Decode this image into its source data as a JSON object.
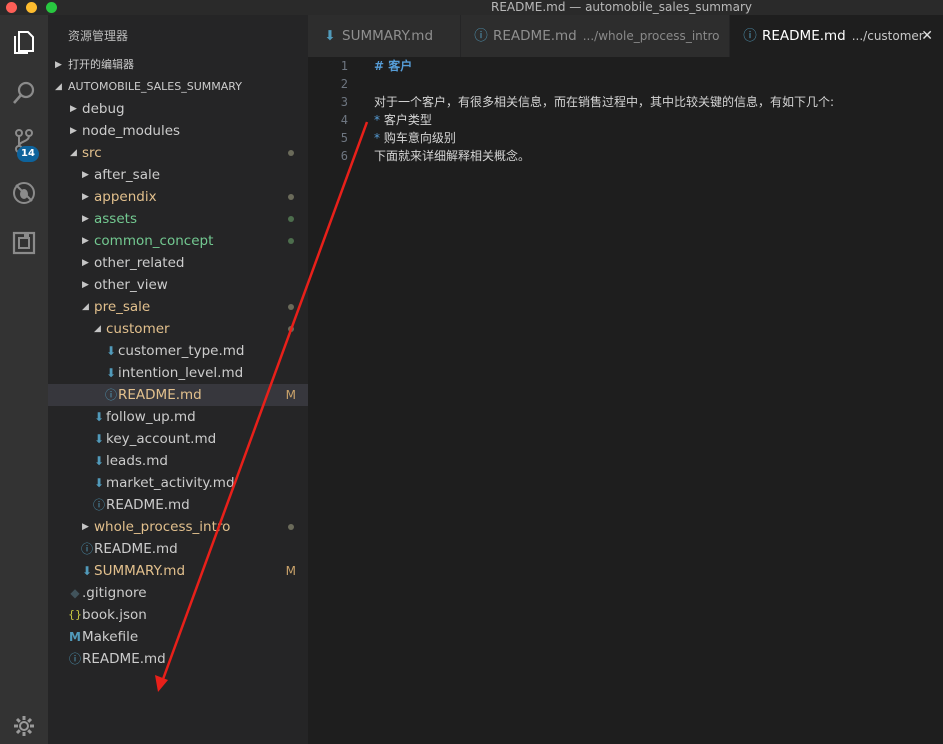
{
  "window": {
    "title": "README.md — automobile_sales_summary"
  },
  "activity_bar": {
    "scm_badge": "14"
  },
  "sidebar": {
    "title": "资源管理器",
    "open_editors_label": "打开的编辑器",
    "project_label": "AUTOMOBILE_SALES_SUMMARY",
    "items": [
      {
        "label": "debug",
        "kind": "folder",
        "depth": 1,
        "expanded": false,
        "color": "folder"
      },
      {
        "label": "node_modules",
        "kind": "folder",
        "depth": 1,
        "expanded": false,
        "color": "folder"
      },
      {
        "label": "src",
        "kind": "folder",
        "depth": 1,
        "expanded": true,
        "color": "mod",
        "dot": "gray"
      },
      {
        "label": "after_sale",
        "kind": "folder",
        "depth": 2,
        "expanded": false,
        "color": "folder"
      },
      {
        "label": "appendix",
        "kind": "folder",
        "depth": 2,
        "expanded": false,
        "color": "mod",
        "dot": "gray"
      },
      {
        "label": "assets",
        "kind": "folder",
        "depth": 2,
        "expanded": false,
        "color": "new",
        "dot": "green"
      },
      {
        "label": "common_concept",
        "kind": "folder",
        "depth": 2,
        "expanded": false,
        "color": "new",
        "dot": "green"
      },
      {
        "label": "other_related",
        "kind": "folder",
        "depth": 2,
        "expanded": false,
        "color": "folder"
      },
      {
        "label": "other_view",
        "kind": "folder",
        "depth": 2,
        "expanded": false,
        "color": "folder"
      },
      {
        "label": "pre_sale",
        "kind": "folder",
        "depth": 2,
        "expanded": true,
        "color": "mod",
        "dot": "gray"
      },
      {
        "label": "customer",
        "kind": "folder",
        "depth": 3,
        "expanded": true,
        "color": "mod",
        "dot": "gray"
      },
      {
        "label": "customer_type.md",
        "kind": "md",
        "depth": 4,
        "color": "folder"
      },
      {
        "label": "intention_level.md",
        "kind": "md",
        "depth": 4,
        "color": "folder"
      },
      {
        "label": "README.md",
        "kind": "info",
        "depth": 4,
        "color": "mod",
        "status": "M",
        "selected": true
      },
      {
        "label": "follow_up.md",
        "kind": "md",
        "depth": 3,
        "color": "folder"
      },
      {
        "label": "key_account.md",
        "kind": "md",
        "depth": 3,
        "color": "folder"
      },
      {
        "label": "leads.md",
        "kind": "md",
        "depth": 3,
        "color": "folder"
      },
      {
        "label": "market_activity.md",
        "kind": "md",
        "depth": 3,
        "color": "folder"
      },
      {
        "label": "README.md",
        "kind": "info",
        "depth": 3,
        "color": "folder"
      },
      {
        "label": "whole_process_intro",
        "kind": "folder",
        "depth": 2,
        "expanded": false,
        "color": "mod",
        "dot": "gray"
      },
      {
        "label": "README.md",
        "kind": "info",
        "depth": 2,
        "color": "folder"
      },
      {
        "label": "SUMMARY.md",
        "kind": "md",
        "depth": 2,
        "color": "mod",
        "status": "M"
      },
      {
        "label": ".gitignore",
        "kind": "git",
        "depth": 1,
        "color": "folder"
      },
      {
        "label": "book.json",
        "kind": "json",
        "depth": 1,
        "color": "folder"
      },
      {
        "label": "Makefile",
        "kind": "make",
        "depth": 1,
        "color": "folder"
      },
      {
        "label": "README.md",
        "kind": "info",
        "depth": 1,
        "color": "folder"
      }
    ]
  },
  "tabs": [
    {
      "label": "SUMMARY.md",
      "desc": "",
      "icon": "markdown-icon",
      "active": false
    },
    {
      "label": "README.md",
      "desc": ".../whole_process_intro",
      "icon": "info-icon",
      "active": false
    },
    {
      "label": "README.md",
      "desc": ".../customer",
      "icon": "info-icon",
      "active": true
    }
  ],
  "editor": {
    "lines": [
      {
        "n": "1",
        "text": "# 客户",
        "style": "heading"
      },
      {
        "n": "2",
        "text": "",
        "style": "normal"
      },
      {
        "n": "3",
        "text": "对于一个客户，有很多相关信息，而在销售过程中，其中比较关键的信息，有如下几个:",
        "style": "normal"
      },
      {
        "n": "4",
        "bullet": "*",
        "text": "客户类型",
        "style": "bullet"
      },
      {
        "n": "5",
        "bullet": "*",
        "text": "购车意向级别",
        "style": "bullet"
      },
      {
        "n": "6",
        "text": "下面就来详细解释相关概念。",
        "style": "normal"
      }
    ]
  },
  "colors": {
    "accent": "#0e639c",
    "modified": "#e2c08d",
    "untracked": "#73c991",
    "annotation_arrow": "#e8201a"
  }
}
